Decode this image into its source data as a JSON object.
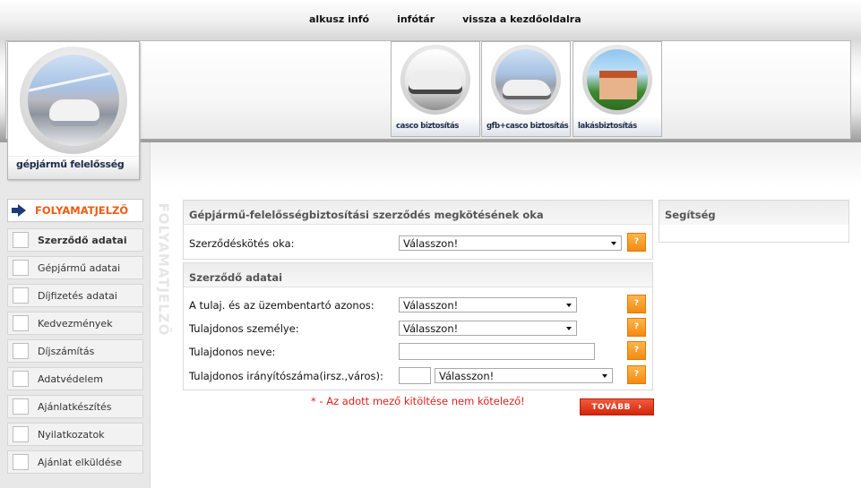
{
  "topnav": {
    "items": [
      "alkusz infó",
      "infótár",
      "vissza a kezdőoldalra"
    ]
  },
  "header": {
    "main_product": "gépjármű felelősség",
    "products": [
      {
        "label": "casco biztosítás"
      },
      {
        "label": "gfb+casco biztosítás"
      },
      {
        "label": "lakásbiztosítás"
      }
    ]
  },
  "progress": {
    "title": "FOLYAMATJELZŐ",
    "vertical_label": "FOLYAMATJELZŐ",
    "steps": [
      {
        "label": "Szerződő adatai",
        "active": true
      },
      {
        "label": "Gépjármű adatai",
        "active": false
      },
      {
        "label": "Díjfizetés adatai",
        "active": false
      },
      {
        "label": "Kedvezmények",
        "active": false
      },
      {
        "label": "Díjszámítás",
        "active": false
      },
      {
        "label": "Adatvédelem",
        "active": false
      },
      {
        "label": "Ajánlatkészítés",
        "active": false
      },
      {
        "label": "Nyilatkozatok",
        "active": false
      },
      {
        "label": "Ajánlat elküldése",
        "active": false
      }
    ]
  },
  "reason_panel": {
    "title": "Gépjármű-felelősségbiztosítási szerződés megkötésének oka",
    "field_label": "Szerződéskötés oka:",
    "select_value": "Válasszon!"
  },
  "contract_panel": {
    "title": "Szerződő adatai",
    "fields": [
      {
        "label": "A tulaj. és az üzembentartó azonos:",
        "value": "Válasszon!"
      },
      {
        "label": "Tulajdonos személye:",
        "value": "Válasszon!"
      },
      {
        "label": "Tulajdonos neve:",
        "value": ""
      },
      {
        "label": "Tulajdonos irányítószáma(irsz.,város):",
        "zip": "",
        "value": "Válasszon!"
      }
    ]
  },
  "help_panel": {
    "title": "Segítség"
  },
  "help_button_label": "?",
  "required_note": "* - Az adott mező kitöltése nem kötelező!",
  "next_button": "TOVÁBB",
  "colors": {
    "accent_orange": "#f05a12",
    "required_red": "#e0201c",
    "button_red": "#d1260b"
  }
}
